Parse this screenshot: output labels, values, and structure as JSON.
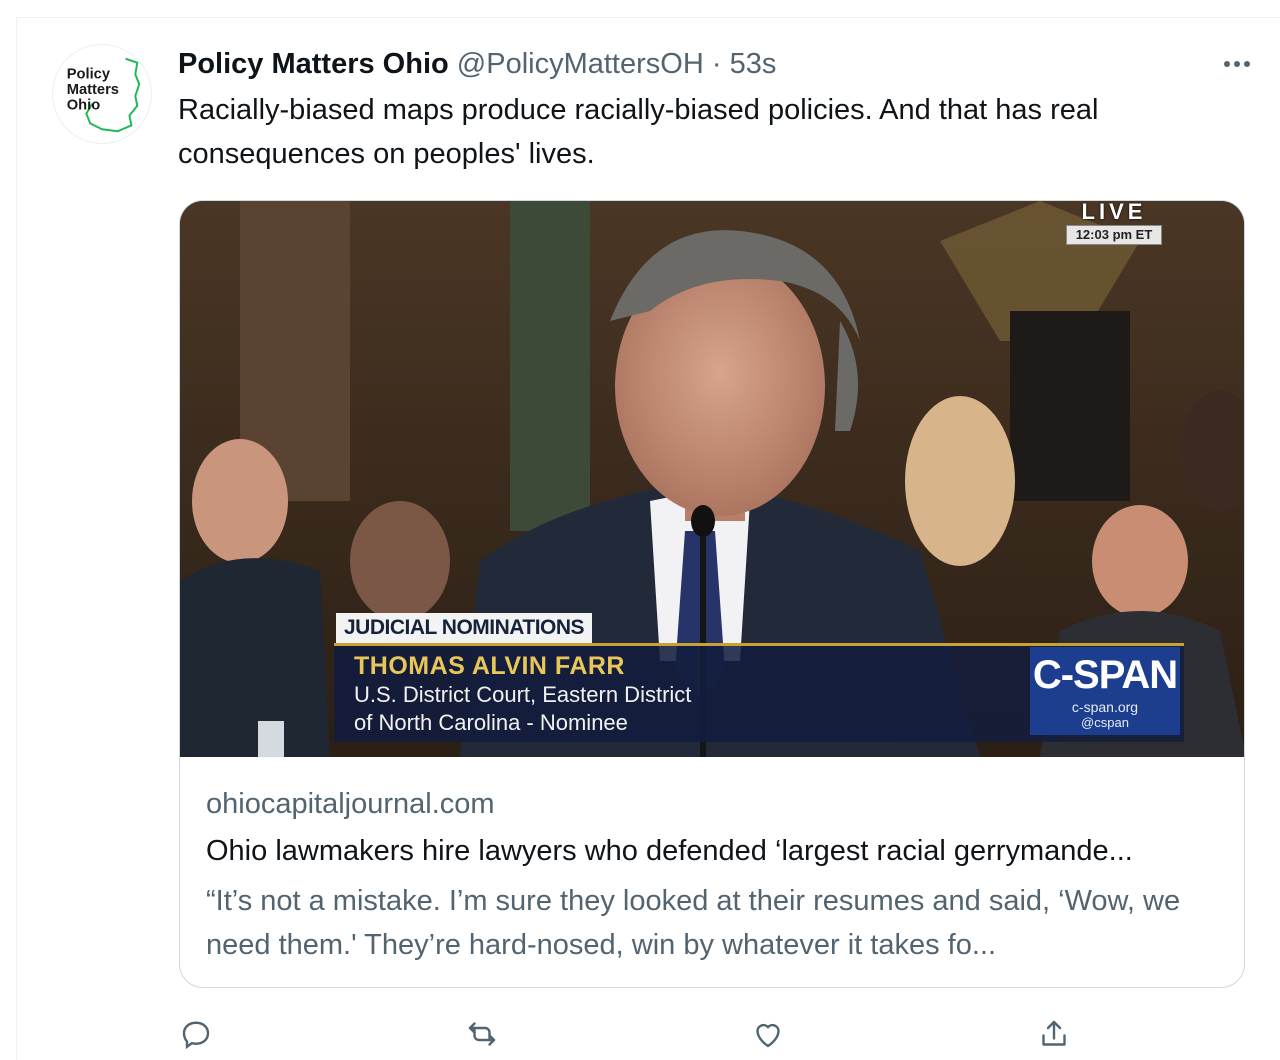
{
  "tweet": {
    "author_name": "Policy Matters Ohio",
    "handle": "@PolicyMattersOH",
    "separator": "·",
    "time": "53s",
    "text": "Racially-biased maps produce racially-biased policies. And that has real consequences on peoples' lives.",
    "avatar_logo": {
      "line1": "Policy",
      "line2": "Matters",
      "line3": "Ohio",
      "color": "#1db954"
    }
  },
  "card": {
    "image": {
      "live_label": "LIVE",
      "live_time": "12:03 pm ET",
      "chyron_label": "JUDICIAL NOMINATIONS",
      "chyron_name": "THOMAS ALVIN FARR",
      "chyron_line2": "U.S. District Court, Eastern District",
      "chyron_line3": "of North Carolina - Nominee",
      "network_logo": "C-SPAN",
      "network_site": "c-span.org",
      "network_handle": "@cspan"
    },
    "domain": "ohiocapitaljournal.com",
    "title": "Ohio lawmakers hire lawyers who defended ‘largest racial gerrymande...",
    "description": "“It’s not a mistake. I’m sure they looked at their resumes and said, ‘Wow, we need them.' They’re hard-nosed, win by whatever it takes fo..."
  },
  "actions": [
    "reply-icon",
    "retweet-icon",
    "like-icon",
    "share-icon"
  ],
  "colors": {
    "secondary_text": "#536471",
    "border": "#cfd9de",
    "cspan_blue": "#1d3d8f",
    "chyron_gold": "#e9c65a"
  }
}
